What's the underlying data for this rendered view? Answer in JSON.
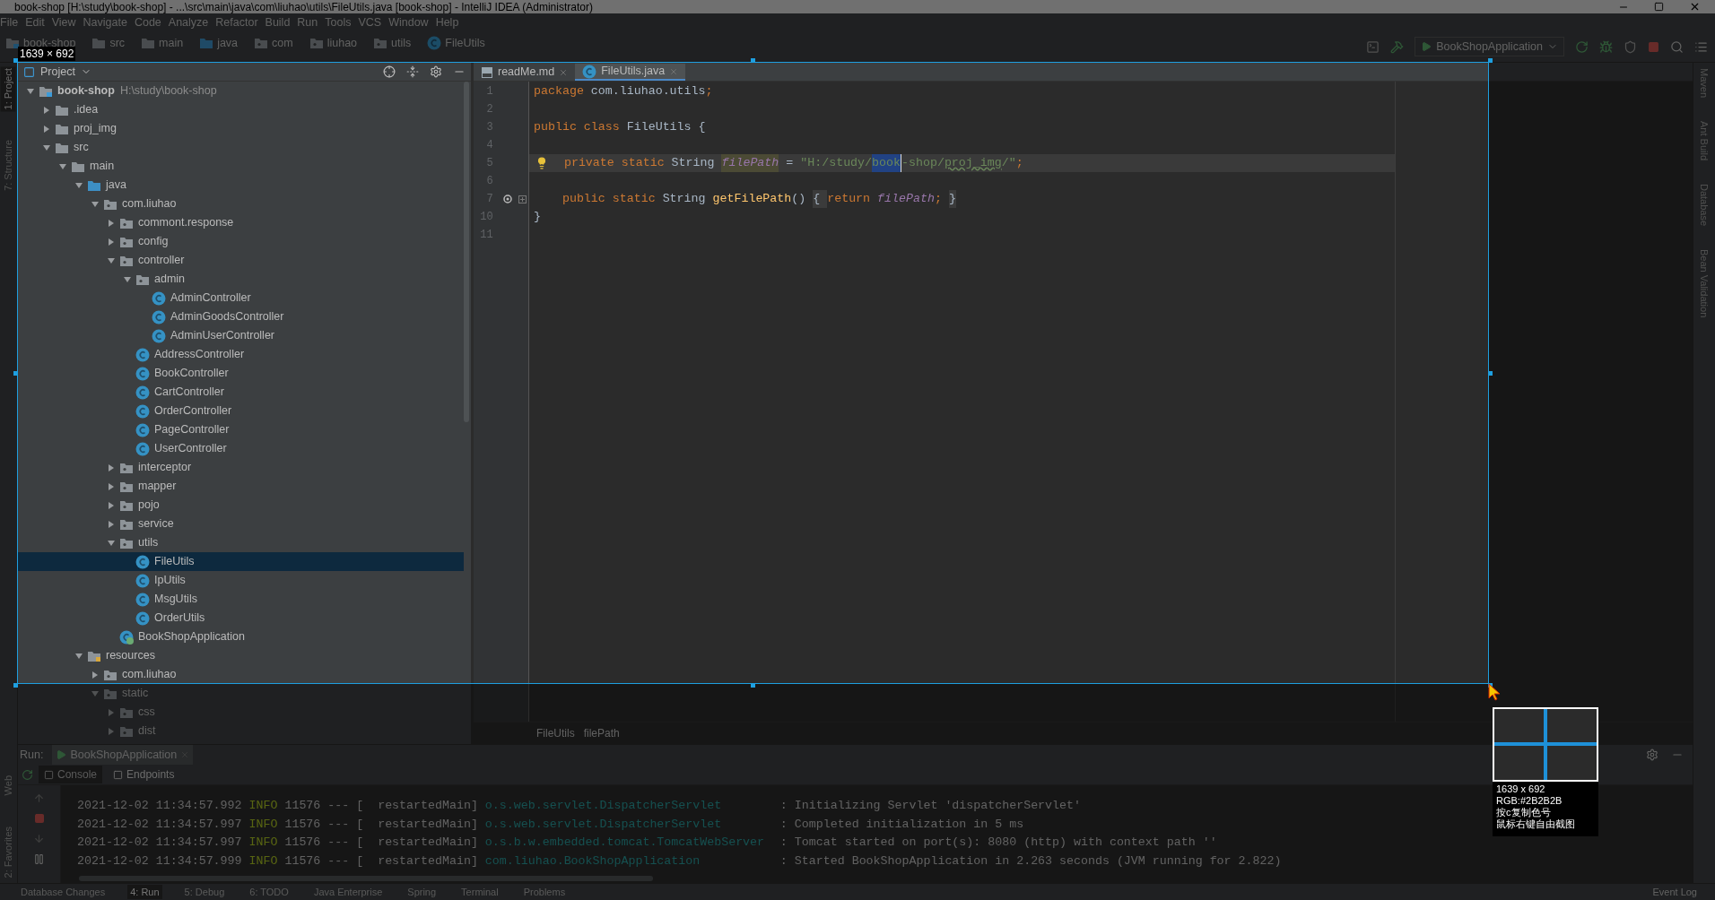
{
  "window": {
    "title": "book-shop [H:\\study\\book-shop] - ...\\src\\main\\java\\com\\liuhao\\utils\\FileUtils.java [book-shop] - IntelliJ IDEA (Administrator)"
  },
  "menu": [
    "File",
    "Edit",
    "View",
    "Navigate",
    "Code",
    "Analyze",
    "Refactor",
    "Build",
    "Run",
    "Tools",
    "VCS",
    "Window",
    "Help"
  ],
  "nav_path": [
    {
      "label": "book-shop",
      "kind": "project"
    },
    {
      "label": "src",
      "kind": "folder"
    },
    {
      "label": "main",
      "kind": "folder"
    },
    {
      "label": "java",
      "kind": "source-folder"
    },
    {
      "label": "com",
      "kind": "package"
    },
    {
      "label": "liuhao",
      "kind": "package"
    },
    {
      "label": "utils",
      "kind": "package"
    },
    {
      "label": "FileUtils",
      "kind": "class"
    }
  ],
  "run_config": {
    "label": "BookShopApplication"
  },
  "left_tool_strip": {
    "top": [
      {
        "label": "1: Project",
        "selected": true
      },
      {
        "label": "7: Structure",
        "selected": false
      }
    ],
    "bottom": [
      {
        "label": "Web",
        "selected": false
      },
      {
        "label": "2: Favorites",
        "selected": false
      }
    ]
  },
  "right_tool_strip": [
    "Maven",
    "Ant Build",
    "Database",
    "Bean Validation"
  ],
  "project_panel": {
    "title": "Project",
    "tree": [
      {
        "name": "book-shop",
        "path": "H:\\study\\book-shop",
        "kind": "project",
        "expanded": true,
        "selected": false,
        "children": [
          {
            "name": ".idea",
            "kind": "folder",
            "expanded": false,
            "selected": false
          },
          {
            "name": "proj_img",
            "kind": "folder",
            "expanded": false,
            "selected": false
          },
          {
            "name": "src",
            "kind": "folder",
            "expanded": true,
            "selected": false,
            "children": [
              {
                "name": "main",
                "kind": "folder",
                "expanded": true,
                "selected": false,
                "children": [
                  {
                    "name": "java",
                    "kind": "source-folder",
                    "expanded": true,
                    "selected": false,
                    "children": [
                      {
                        "name": "com.liuhao",
                        "kind": "package",
                        "expanded": true,
                        "selected": false,
                        "children": [
                          {
                            "name": "commont.response",
                            "kind": "package",
                            "expanded": false,
                            "selected": false
                          },
                          {
                            "name": "config",
                            "kind": "package",
                            "expanded": false,
                            "selected": false
                          },
                          {
                            "name": "controller",
                            "kind": "package",
                            "expanded": true,
                            "selected": false,
                            "children": [
                              {
                                "name": "admin",
                                "kind": "package",
                                "expanded": true,
                                "selected": false,
                                "children": [
                                  {
                                    "name": "AdminController",
                                    "kind": "class",
                                    "selected": false
                                  },
                                  {
                                    "name": "AdminGoodsController",
                                    "kind": "class",
                                    "selected": false
                                  },
                                  {
                                    "name": "AdminUserController",
                                    "kind": "class",
                                    "selected": false
                                  }
                                ]
                              },
                              {
                                "name": "AddressController",
                                "kind": "class",
                                "selected": false
                              },
                              {
                                "name": "BookController",
                                "kind": "class",
                                "selected": false
                              },
                              {
                                "name": "CartController",
                                "kind": "class",
                                "selected": false
                              },
                              {
                                "name": "OrderController",
                                "kind": "class",
                                "selected": false
                              },
                              {
                                "name": "PageController",
                                "kind": "class",
                                "selected": false
                              },
                              {
                                "name": "UserController",
                                "kind": "class",
                                "selected": false
                              }
                            ]
                          },
                          {
                            "name": "interceptor",
                            "kind": "package",
                            "expanded": false,
                            "selected": false
                          },
                          {
                            "name": "mapper",
                            "kind": "package",
                            "expanded": false,
                            "selected": false
                          },
                          {
                            "name": "pojo",
                            "kind": "package",
                            "expanded": false,
                            "selected": false
                          },
                          {
                            "name": "service",
                            "kind": "package",
                            "expanded": false,
                            "selected": false
                          },
                          {
                            "name": "utils",
                            "kind": "package",
                            "expanded": true,
                            "selected": false,
                            "children": [
                              {
                                "name": "FileUtils",
                                "kind": "class",
                                "selected": true
                              },
                              {
                                "name": "IpUtils",
                                "kind": "class",
                                "selected": false
                              },
                              {
                                "name": "MsgUtils",
                                "kind": "class",
                                "selected": false
                              },
                              {
                                "name": "OrderUtils",
                                "kind": "class",
                                "selected": false
                              }
                            ]
                          },
                          {
                            "name": "BookShopApplication",
                            "kind": "app",
                            "selected": false
                          }
                        ]
                      }
                    ]
                  },
                  {
                    "name": "resources",
                    "kind": "resources",
                    "expanded": true,
                    "selected": false,
                    "children": [
                      {
                        "name": "com.liuhao",
                        "kind": "package",
                        "expanded": false,
                        "selected": false
                      },
                      {
                        "name": "static",
                        "kind": "package",
                        "expanded": true,
                        "selected": false,
                        "children": [
                          {
                            "name": "css",
                            "kind": "package",
                            "expanded": false,
                            "selected": false
                          },
                          {
                            "name": "dist",
                            "kind": "package",
                            "expanded": false,
                            "selected": false
                          }
                        ]
                      }
                    ]
                  }
                ]
              }
            ]
          }
        ]
      }
    ]
  },
  "editor": {
    "tabs": [
      {
        "label": "readMe.md",
        "kind": "markdown",
        "selected": false
      },
      {
        "label": "FileUtils.java",
        "kind": "class",
        "selected": true
      }
    ],
    "lines": [
      {
        "number": "1",
        "kind": "code",
        "current": false,
        "tokens": [
          {
            "text": "package ",
            "kind": "keyword"
          },
          {
            "text": "com.liuhao.utils",
            "kind": "plain"
          },
          {
            "text": ";",
            "kind": "keyword"
          }
        ]
      },
      {
        "number": "2",
        "kind": "blank",
        "current": false
      },
      {
        "number": "3",
        "kind": "code",
        "current": false,
        "tokens": [
          {
            "text": "public class ",
            "kind": "keyword"
          },
          {
            "text": "FileUtils {",
            "kind": "plain"
          }
        ]
      },
      {
        "number": "4",
        "kind": "blank",
        "current": false
      },
      {
        "number": "5",
        "kind": "bulb-line",
        "current": true,
        "tokens": [
          {
            "text": "    private static ",
            "kind": "keyword"
          },
          {
            "text": "String ",
            "kind": "plain"
          },
          {
            "text": "filePath",
            "kind": "field-declared"
          },
          {
            "text": " = ",
            "kind": "plain"
          },
          {
            "text": "\"H:/study/",
            "kind": "string"
          },
          {
            "text": "book",
            "kind": "string-selected"
          },
          {
            "text": "-shop/",
            "kind": "string"
          },
          {
            "text": "proj_img",
            "kind": "string-typo"
          },
          {
            "text": "/\"",
            "kind": "string"
          },
          {
            "text": ";",
            "kind": "keyword"
          }
        ]
      },
      {
        "number": "6",
        "kind": "blank",
        "current": false
      },
      {
        "number": "7",
        "kind": "method-line",
        "current": false,
        "tokens": [
          {
            "text": "    public static ",
            "kind": "keyword"
          },
          {
            "text": "String ",
            "kind": "plain"
          },
          {
            "text": "getFilePath",
            "kind": "method"
          },
          {
            "text": "() ",
            "kind": "plain"
          },
          {
            "text": "{ ",
            "kind": "fold"
          },
          {
            "text": "return ",
            "kind": "keyword"
          },
          {
            "text": "filePath",
            "kind": "field"
          },
          {
            "text": "; ",
            "kind": "keyword"
          },
          {
            "text": "}",
            "kind": "fold"
          }
        ]
      },
      {
        "number": "10",
        "kind": "code",
        "current": false,
        "tokens": [
          {
            "text": "}",
            "kind": "plain"
          }
        ]
      },
      {
        "number": "11",
        "kind": "blank",
        "current": false
      }
    ],
    "breadcrumb": [
      "FileUtils",
      "filePath"
    ]
  },
  "run_panel": {
    "title": "Run:",
    "config_tab": "BookShopApplication",
    "tabs": [
      {
        "label": "Console",
        "selected": true
      },
      {
        "label": "Endpoints",
        "selected": false
      }
    ],
    "log": [
      {
        "time": "2021-12-02 11:34:57.992",
        "level": "INFO",
        "process": "11576 --- [  restartedMain]",
        "logger": "o.s.web.servlet.DispatcherServlet",
        "message": ": Initializing Servlet 'dispatcherServlet'"
      },
      {
        "time": "2021-12-02 11:34:57.997",
        "level": "INFO",
        "process": "11576 --- [  restartedMain]",
        "logger": "o.s.web.servlet.DispatcherServlet",
        "message": ": Completed initialization in 5 ms"
      },
      {
        "time": "2021-12-02 11:34:57.997",
        "level": "INFO",
        "process": "11576 --- [  restartedMain]",
        "logger": "o.s.b.w.embedded.tomcat.TomcatWebServer",
        "message": ": Tomcat started on port(s): 8080 (http) with context path ''"
      },
      {
        "time": "2021-12-02 11:34:57.999",
        "level": "INFO",
        "process": "11576 --- [  restartedMain]",
        "logger": "com.liuhao.BookShopApplication",
        "message": ": Started BookShopApplication in 2.263 seconds (JVM running for 2.822)"
      }
    ]
  },
  "status_bar": {
    "tools": [
      {
        "label": "Database Changes",
        "selected": false
      },
      {
        "label": "4: Run",
        "selected": true
      },
      {
        "label": "5: Debug",
        "selected": false
      },
      {
        "label": "6: TODO",
        "selected": false
      },
      {
        "label": "Java Enterprise",
        "selected": false
      },
      {
        "label": "Spring",
        "selected": false
      },
      {
        "label": "Terminal",
        "selected": false
      },
      {
        "label": "Problems",
        "selected": false
      }
    ],
    "event_log": "Event Log"
  },
  "screen_capture": {
    "size_label": "1639 × 692",
    "magnifier_lines": [
      "1639 x 692",
      "RGB:#2B2B2B",
      "按c复制色号",
      "鼠标右键自由截图"
    ]
  }
}
